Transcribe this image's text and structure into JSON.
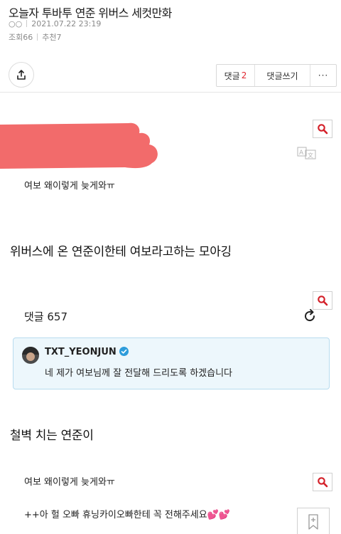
{
  "post": {
    "title": "오늘자 투바투 연준 위버스 세컷만화",
    "author_dots": "○○",
    "date": "2021.07.22 23:19",
    "views": "조회66",
    "recommends": "추천7"
  },
  "actions": {
    "comment_label": "댓글",
    "comment_count": "2",
    "write_label": "댓글쓰기",
    "more_label": "···"
  },
  "content": {
    "caption1": "여보 왜이렇게 늦게와ㅠ",
    "heading1": "위버스에 온 연준이한테 여보라고하는 모아깅",
    "comment_count_label": "댓글 657",
    "reply": {
      "username": "TXT_YEONJUN",
      "text": "네 제가 여보님께 잘 전달해 드리도록 하겠습니다"
    },
    "heading2": "철벽 치는 연준이",
    "caption2": "여보 왜이렇게 늦게와ㅠ",
    "caption3": "++아 헐 오빠 휴닝카이오빠한테 꼭 전해주세요💕💕"
  },
  "colors": {
    "accent_red": "#e0262f",
    "redaction_red": "#f26b6b",
    "card_bg": "#edf7fc",
    "card_border": "#b8dcef",
    "verified_blue": "#2d9cdb"
  },
  "icons": [
    "share-icon",
    "magnifier-icon",
    "translate-icon",
    "refresh-icon",
    "verified-icon",
    "bookmark-icon"
  ]
}
